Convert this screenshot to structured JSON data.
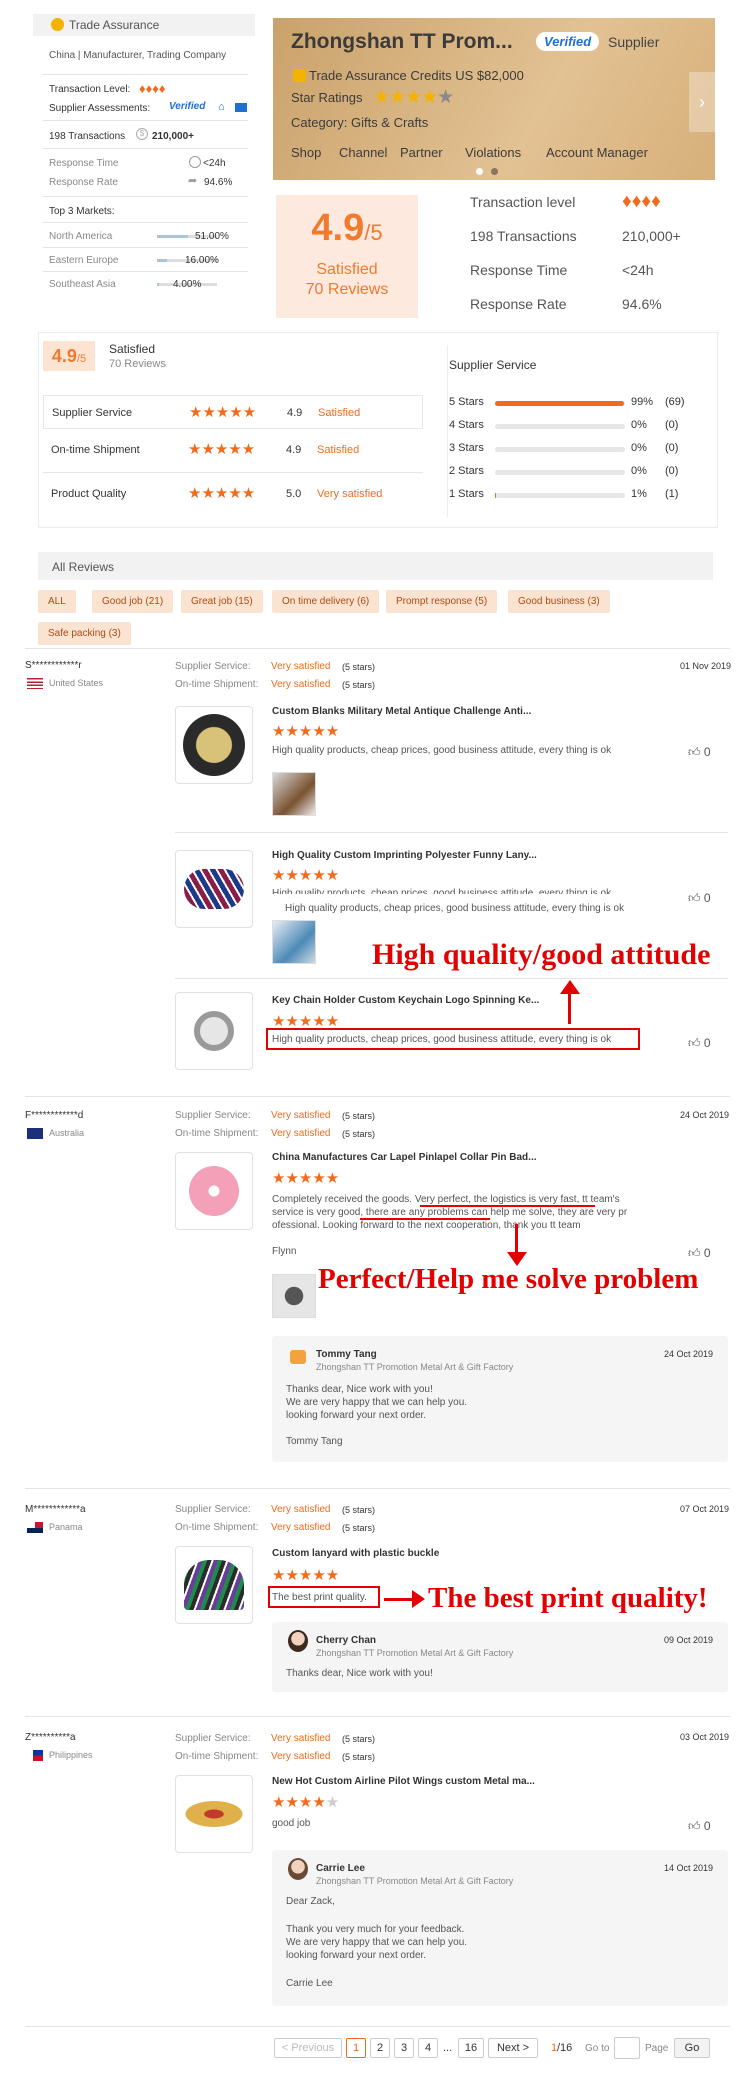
{
  "supplier_card": {
    "trade_assurance": "Trade Assurance",
    "business_type": "China  |  Manufacturer, Trading Company",
    "transaction_level_label": "Transaction Level:",
    "assessments_label": "Supplier Assessments:",
    "verified_badge": "Verified",
    "transactions": "198 Transactions",
    "amount": "210,000+",
    "response_time_label": "Response Time",
    "response_time_value": "<24h",
    "response_rate_label": "Response Rate",
    "response_rate_value": "94.6%",
    "top_markets_label": "Top 3 Markets:",
    "markets": [
      {
        "name": "North America",
        "value": "51.00%",
        "fraction": 0.51
      },
      {
        "name": "Eastern Europe",
        "value": "16.00%",
        "fraction": 0.16
      },
      {
        "name": "Southeast Asia",
        "value": "4.00%",
        "fraction": 0.04
      }
    ]
  },
  "banner": {
    "company": "Zhongshan TT Prom...",
    "verified": "Verified",
    "supplier": "Supplier",
    "credits": "Trade Assurance Credits US $82,000",
    "star_ratings": "Star Ratings",
    "category": "Category: Gifts & Crafts",
    "nav": [
      "Shop",
      "Channel",
      "Partner",
      "Violations",
      "Account Manager"
    ]
  },
  "rating_box": {
    "score": "4.9",
    "out_of": "/5",
    "label": "Satisfied",
    "reviews": "70 Reviews"
  },
  "stats_table": [
    {
      "label": "Transaction level",
      "value": ""
    },
    {
      "label": "198 Transactions",
      "value": "210,000+"
    },
    {
      "label": "Response Time",
      "value": "<24h"
    },
    {
      "label": "Response Rate",
      "value": "94.6%"
    }
  ],
  "summary": {
    "score": "4.9",
    "out_of": "/5",
    "label": "Satisfied",
    "reviews": "70 Reviews",
    "rows": [
      {
        "label": "Supplier Service",
        "score": "4.9",
        "text": "Satisfied"
      },
      {
        "label": "On-time Shipment",
        "score": "4.9",
        "text": "Satisfied"
      },
      {
        "label": "Product Quality",
        "score": "5.0",
        "text": "Very satisfied"
      }
    ],
    "supplier_service_title": "Supplier Service",
    "star_bars": [
      {
        "label": "5 Stars",
        "pct": "99%",
        "count": "(69)",
        "fraction": 0.99
      },
      {
        "label": "4 Stars",
        "pct": "0%",
        "count": "(0)",
        "fraction": 0
      },
      {
        "label": "3 Stars",
        "pct": "0%",
        "count": "(0)",
        "fraction": 0
      },
      {
        "label": "2 Stars",
        "pct": "0%",
        "count": "(0)",
        "fraction": 0
      },
      {
        "label": "1 Stars",
        "pct": "1%",
        "count": "(1)",
        "fraction": 0.01
      }
    ]
  },
  "all_reviews": {
    "title": "All Reviews",
    "tags": [
      "ALL",
      "Good job (21)",
      "Great job (15)",
      "On time delivery (6)",
      "Prompt response (5)",
      "Good business (3)",
      "Safe packing (3)"
    ]
  },
  "labels": {
    "supplier_service": "Supplier Service:",
    "ontime": "On-time Shipment:",
    "very_satisfied": "Very satisfied",
    "five_stars": "(5 stars)",
    "zero": "0"
  },
  "reviews": [
    {
      "user": "S************r",
      "country": "United States",
      "date": "01 Nov 2019",
      "items": [
        {
          "title": "Custom Blanks Military Metal Antique Challenge Anti...",
          "text": "High quality products, cheap prices, good business attitude, every thing is ok"
        },
        {
          "title": "High Quality Custom Imprinting Polyester Funny Lany...",
          "text": "High quality products, cheap prices, good business attitude, every thing is ok",
          "overlap_text": "High quality products, cheap prices, good business attitude, every thing is ok"
        },
        {
          "title": "Key Chain Holder Custom Keychain Logo Spinning Ke...",
          "text": "High quality products, cheap prices, good business attitude, every thing is ok"
        }
      ]
    },
    {
      "user": "F************d",
      "country": "Australia",
      "date": "24 Oct 2019",
      "title": "China Manufactures Car Lapel Pinlapel Collar Pin Bad...",
      "text_lines": [
        "Completely received the goods. Very perfect, the logistics is very fast, tt team's",
        "service is very good, there are any problems can help me solve, they are very pr",
        "ofessional. Looking forward to the next cooperation, thank you tt team"
      ],
      "signature": "Flynn",
      "reply": {
        "name": "Tommy Tang",
        "company": "Zhongshan TT Promotion Metal Art & Gift Factory",
        "date": "24 Oct 2019",
        "lines": [
          "Thanks dear, Nice work with you!",
          "We are very happy that we can help you.",
          "looking forward your next order.",
          "",
          "Tommy Tang"
        ]
      }
    },
    {
      "user": "M************a",
      "country": "Panama",
      "date": "07 Oct 2019",
      "title": "Custom lanyard with plastic buckle",
      "text": "The best print quality.",
      "reply": {
        "name": "Cherry Chan",
        "company": "Zhongshan TT Promotion Metal Art & Gift Factory",
        "date": "09 Oct 2019",
        "lines": [
          "Thanks dear, Nice work with you!"
        ]
      }
    },
    {
      "user": "Z**********a",
      "country": "Philippines",
      "date": "03 Oct 2019",
      "title": "New Hot Custom Airline Pilot Wings custom Metal ma...",
      "text": "good job",
      "reply": {
        "name": "Carrie Lee",
        "company": "Zhongshan TT Promotion Metal Art & Gift Factory",
        "date": "14 Oct 2019",
        "lines": [
          "Dear Zack,",
          "",
          "Thank you very much for your feedback.",
          "We are very happy that we can help you.",
          "looking forward your next order.",
          "",
          "Carrie Lee"
        ]
      }
    }
  ],
  "annotations": {
    "a1": "High quality/good attitude",
    "a2": "Perfect/Help me solve problem",
    "a3": "The best print quality!"
  },
  "pagination": {
    "previous": "< Previous",
    "pages": [
      "1",
      "2",
      "3",
      "4",
      "...",
      "16"
    ],
    "next": "Next >",
    "current": "1",
    "total": "/16",
    "goto": "Go to",
    "page": "Page",
    "go": "Go"
  }
}
